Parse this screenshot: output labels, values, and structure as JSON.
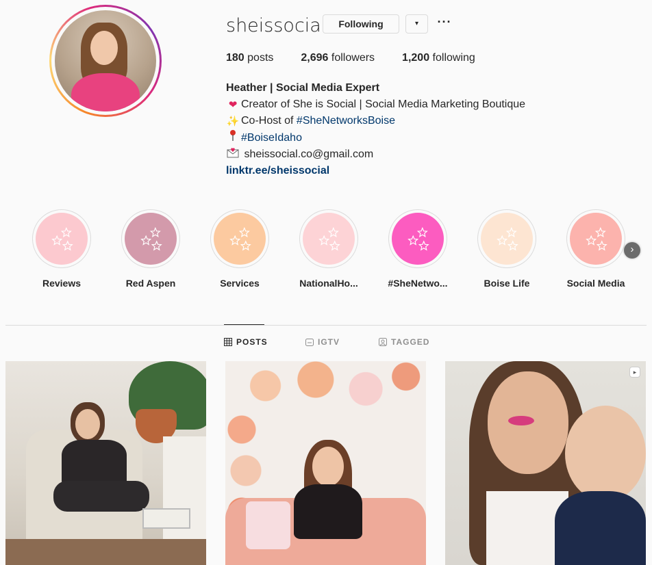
{
  "profile": {
    "username": "sheissocial",
    "following_button_label": "Following",
    "dropdown_symbol": "▾",
    "more_symbol": "···",
    "avatar_icon": "profile-photo",
    "stats": {
      "posts_count": "180",
      "posts_label": "posts",
      "followers_count": "2,696",
      "followers_label": "followers",
      "following_count": "1,200",
      "following_label": "following"
    },
    "bio": {
      "name": "Heather | Social Media Expert",
      "line1_emoji": "❤",
      "line1_text": "Creator of She is Social | Social Media Marketing Boutique",
      "line2_emoji": "✨",
      "line2_prefix": "Co-Host of ",
      "line2_link": "#SheNetworksBoise",
      "line3_emoji": "📍",
      "line3_link": "#BoiseIdaho",
      "line4_emoji": "✉",
      "line4_text": " sheissocial.co@gmail.com",
      "website": "linktr.ee/sheissocial"
    }
  },
  "highlights": [
    {
      "label": "Reviews",
      "color": "#fcc9cf"
    },
    {
      "label": "Red Aspen",
      "color": "#d39aab"
    },
    {
      "label": "Services",
      "color": "#fccaa0"
    },
    {
      "label": "NationalHo...",
      "color": "#fdd3d6"
    },
    {
      "label": "#SheNetwo...",
      "color": "#fc5cc0"
    },
    {
      "label": "Boise Life",
      "color": "#fde5d2"
    },
    {
      "label": "Social Media",
      "color": "#fcb3ad"
    }
  ],
  "highlights_next_icon": "chevron-right-icon",
  "tabs": [
    {
      "label": "POSTS",
      "icon": "grid-icon",
      "active": true
    },
    {
      "label": "IGTV",
      "icon": "igtv-icon",
      "active": false
    },
    {
      "label": "TAGGED",
      "icon": "tagged-icon",
      "active": false
    }
  ],
  "posts": [
    {
      "description_icon": "photo",
      "type": "image"
    },
    {
      "description_icon": "photo",
      "type": "image"
    },
    {
      "description_icon": "video",
      "type": "video"
    }
  ],
  "colors": {
    "link": "#00376b",
    "text": "#262626",
    "muted": "#8e8e8e",
    "border": "#dbdbdb",
    "background": "#fafafa"
  }
}
